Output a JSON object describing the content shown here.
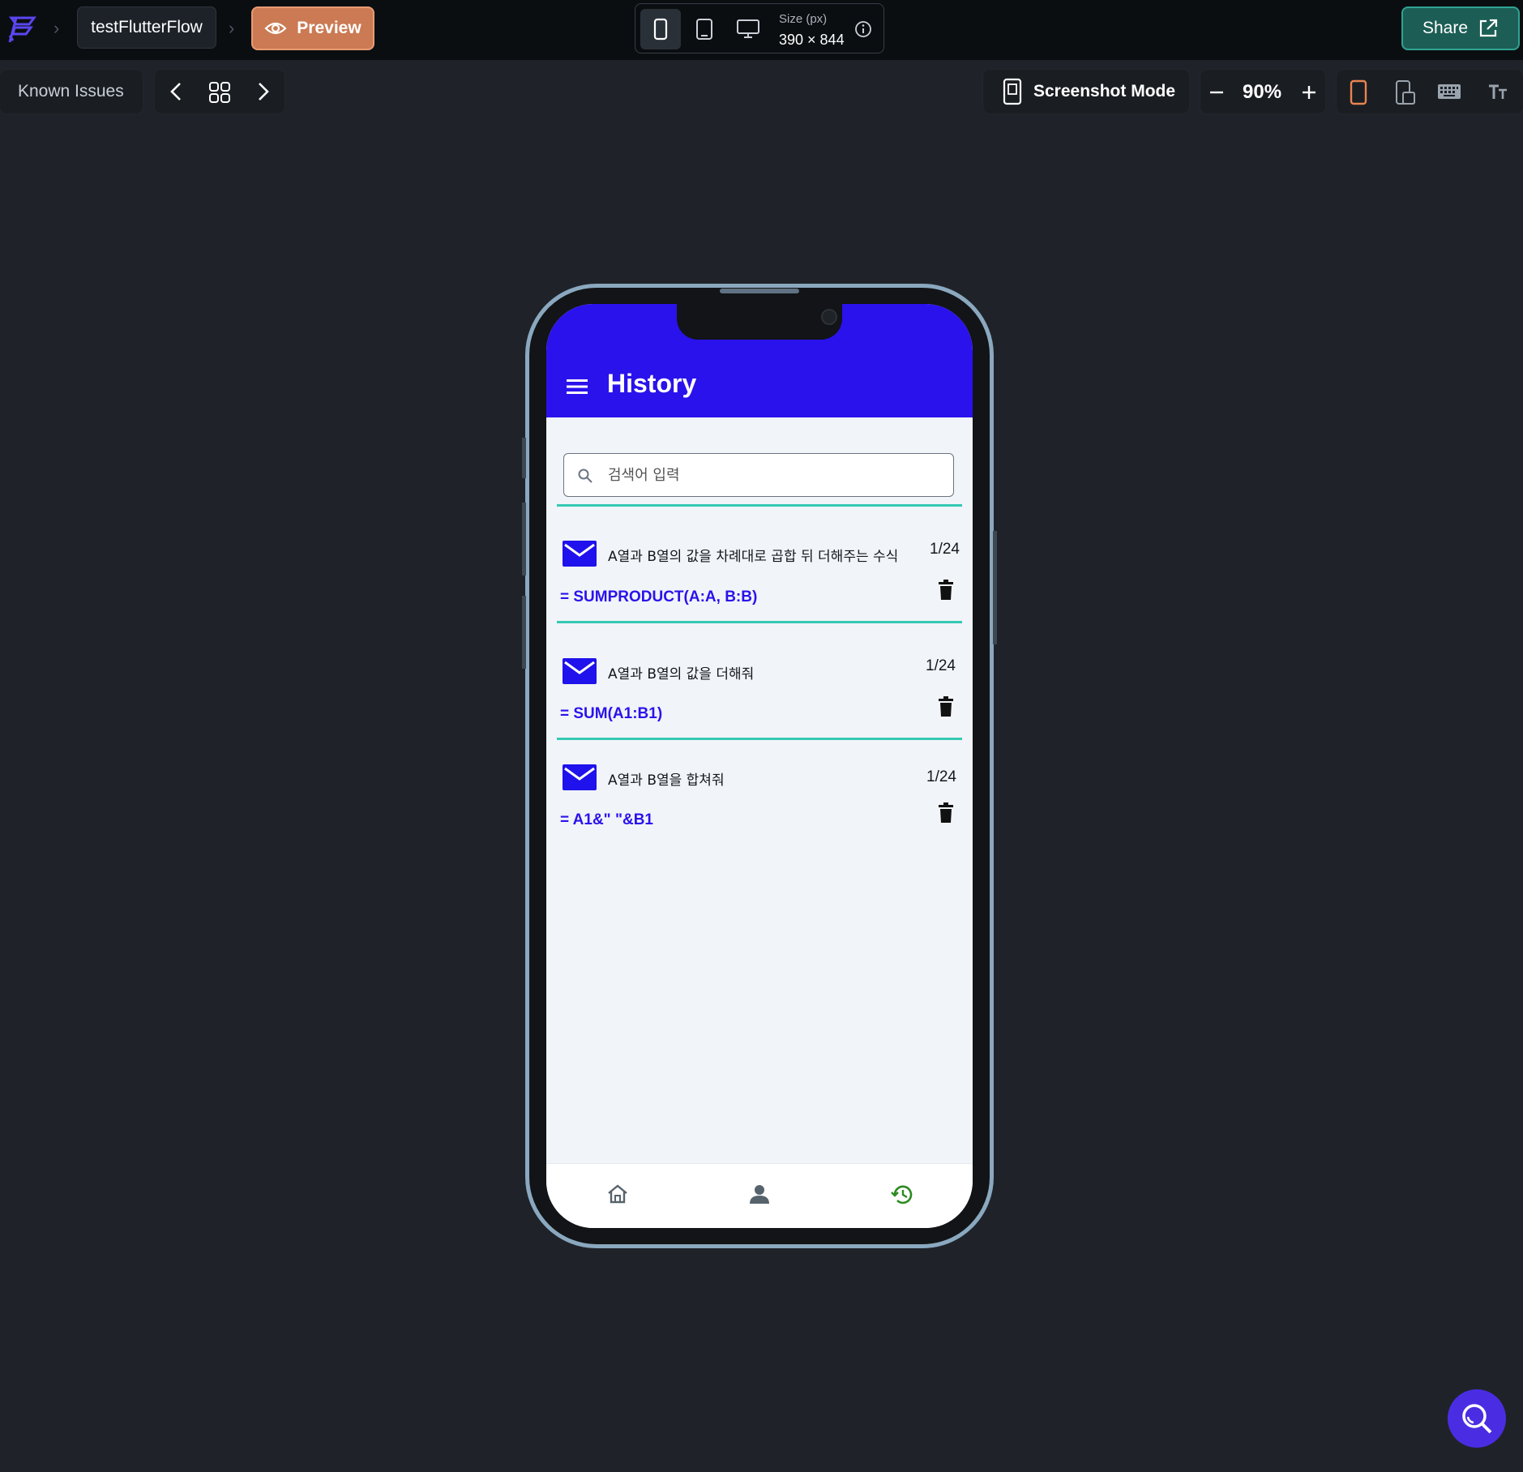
{
  "topbar": {
    "project_name": "testFlutterFlow",
    "preview_label": "Preview",
    "size_label": "Size (px)",
    "size_value": "390 × 844",
    "share_label": "Share"
  },
  "toolbar": {
    "known_issues": "Known Issues",
    "screenshot_mode": "Screenshot Mode",
    "zoom": "90%"
  },
  "app": {
    "title": "History",
    "search_placeholder": "검색어 입력",
    "items": [
      {
        "title": "A열과 B열의 값을 차례대로 곱합 뒤 더해주는 수식",
        "count": "1/24",
        "formula": "= SUMPRODUCT(A:A, B:B)"
      },
      {
        "title": "A열과 B열의 값을 더해줘",
        "count": "1/24",
        "formula": "= SUM(A1:B1)"
      },
      {
        "title": "A열과 B열을 합쳐줘",
        "count": "1/24",
        "formula": "= A1&\" \"&B1"
      }
    ]
  },
  "colors": {
    "appbar": "#2a12ec",
    "divider": "#35c9b4",
    "preview_accent": "#cb7a53",
    "share_accent": "#1c5e55",
    "active_nav": "#2b8a1f"
  }
}
